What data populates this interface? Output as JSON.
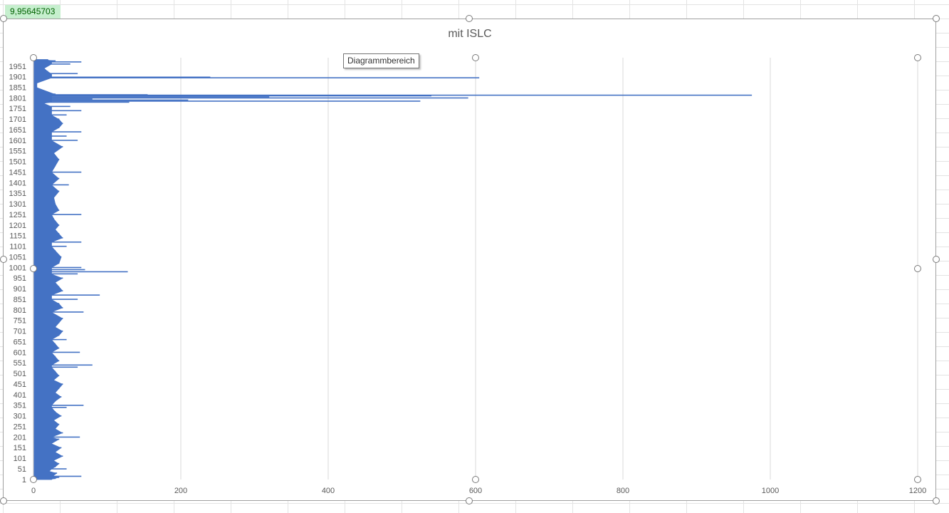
{
  "cell": {
    "value": "9,95645703"
  },
  "tooltip": {
    "text": "Diagrammbereich"
  },
  "colors": {
    "bar": "#4472c4",
    "gridline": "#d9d9d9",
    "text": "#595959"
  },
  "chart_data": {
    "type": "bar",
    "orientation": "horizontal",
    "title": "mit ISLC",
    "xlim": [
      0,
      1200
    ],
    "x_ticks": [
      0,
      200,
      400,
      600,
      800,
      1000,
      1200
    ],
    "y_tick_labels": [
      "1",
      "51",
      "101",
      "151",
      "201",
      "251",
      "301",
      "351",
      "401",
      "451",
      "501",
      "551",
      "601",
      "651",
      "701",
      "751",
      "801",
      "851",
      "901",
      "951",
      "1001",
      "1051",
      "1101",
      "1151",
      "1201",
      "1251",
      "1301",
      "1351",
      "1401",
      "1451",
      "1501",
      "1551",
      "1601",
      "1651",
      "1701",
      "1751",
      "1801",
      "1851",
      "1901",
      "1951"
    ],
    "category_range": [
      1,
      1990
    ],
    "grid": "vertical-major",
    "legend": "none",
    "series": [
      {
        "points": [
          [
            1,
            25
          ],
          [
            5,
            30
          ],
          [
            10,
            35
          ],
          [
            15,
            65
          ],
          [
            20,
            28
          ],
          [
            30,
            32
          ],
          [
            40,
            22
          ],
          [
            50,
            45
          ],
          [
            60,
            30
          ],
          [
            75,
            35
          ],
          [
            90,
            28
          ],
          [
            110,
            40
          ],
          [
            130,
            30
          ],
          [
            150,
            38
          ],
          [
            170,
            25
          ],
          [
            190,
            35
          ],
          [
            200,
            63
          ],
          [
            220,
            40
          ],
          [
            240,
            30
          ],
          [
            260,
            35
          ],
          [
            280,
            28
          ],
          [
            300,
            38
          ],
          [
            320,
            30
          ],
          [
            340,
            45
          ],
          [
            350,
            68
          ],
          [
            370,
            30
          ],
          [
            390,
            38
          ],
          [
            410,
            30
          ],
          [
            430,
            35
          ],
          [
            450,
            40
          ],
          [
            470,
            28
          ],
          [
            490,
            35
          ],
          [
            510,
            30
          ],
          [
            530,
            60
          ],
          [
            540,
            80
          ],
          [
            560,
            35
          ],
          [
            580,
            30
          ],
          [
            600,
            63
          ],
          [
            620,
            35
          ],
          [
            640,
            30
          ],
          [
            660,
            45
          ],
          [
            680,
            35
          ],
          [
            700,
            40
          ],
          [
            720,
            30
          ],
          [
            740,
            35
          ],
          [
            760,
            40
          ],
          [
            790,
            68
          ],
          [
            810,
            40
          ],
          [
            830,
            35
          ],
          [
            850,
            60
          ],
          [
            870,
            90
          ],
          [
            890,
            40
          ],
          [
            910,
            35
          ],
          [
            930,
            30
          ],
          [
            950,
            40
          ],
          [
            970,
            60
          ],
          [
            980,
            128
          ],
          [
            990,
            70
          ],
          [
            1000,
            65
          ],
          [
            1020,
            35
          ],
          [
            1050,
            38
          ],
          [
            1080,
            30
          ],
          [
            1100,
            45
          ],
          [
            1120,
            65
          ],
          [
            1140,
            40
          ],
          [
            1160,
            35
          ],
          [
            1180,
            30
          ],
          [
            1200,
            35
          ],
          [
            1230,
            28
          ],
          [
            1250,
            65
          ],
          [
            1270,
            35
          ],
          [
            1300,
            30
          ],
          [
            1330,
            28
          ],
          [
            1360,
            35
          ],
          [
            1390,
            48
          ],
          [
            1420,
            35
          ],
          [
            1450,
            65
          ],
          [
            1480,
            30
          ],
          [
            1510,
            35
          ],
          [
            1540,
            28
          ],
          [
            1570,
            40
          ],
          [
            1600,
            60
          ],
          [
            1620,
            45
          ],
          [
            1640,
            65
          ],
          [
            1660,
            35
          ],
          [
            1680,
            40
          ],
          [
            1700,
            35
          ],
          [
            1720,
            45
          ],
          [
            1740,
            65
          ],
          [
            1760,
            50
          ],
          [
            1775,
            15
          ],
          [
            1780,
            130
          ],
          [
            1785,
            525
          ],
          [
            1790,
            210
          ],
          [
            1795,
            80
          ],
          [
            1800,
            590
          ],
          [
            1805,
            320
          ],
          [
            1810,
            540
          ],
          [
            1813,
            975
          ],
          [
            1815,
            155
          ],
          [
            1818,
            30
          ],
          [
            1850,
            5
          ],
          [
            1870,
            5
          ],
          [
            1895,
            605
          ],
          [
            1898,
            240
          ],
          [
            1905,
            25
          ],
          [
            1915,
            60
          ],
          [
            1925,
            20
          ],
          [
            1940,
            15
          ],
          [
            1960,
            50
          ],
          [
            1970,
            65
          ],
          [
            1975,
            30
          ],
          [
            1980,
            20
          ]
        ]
      }
    ]
  }
}
